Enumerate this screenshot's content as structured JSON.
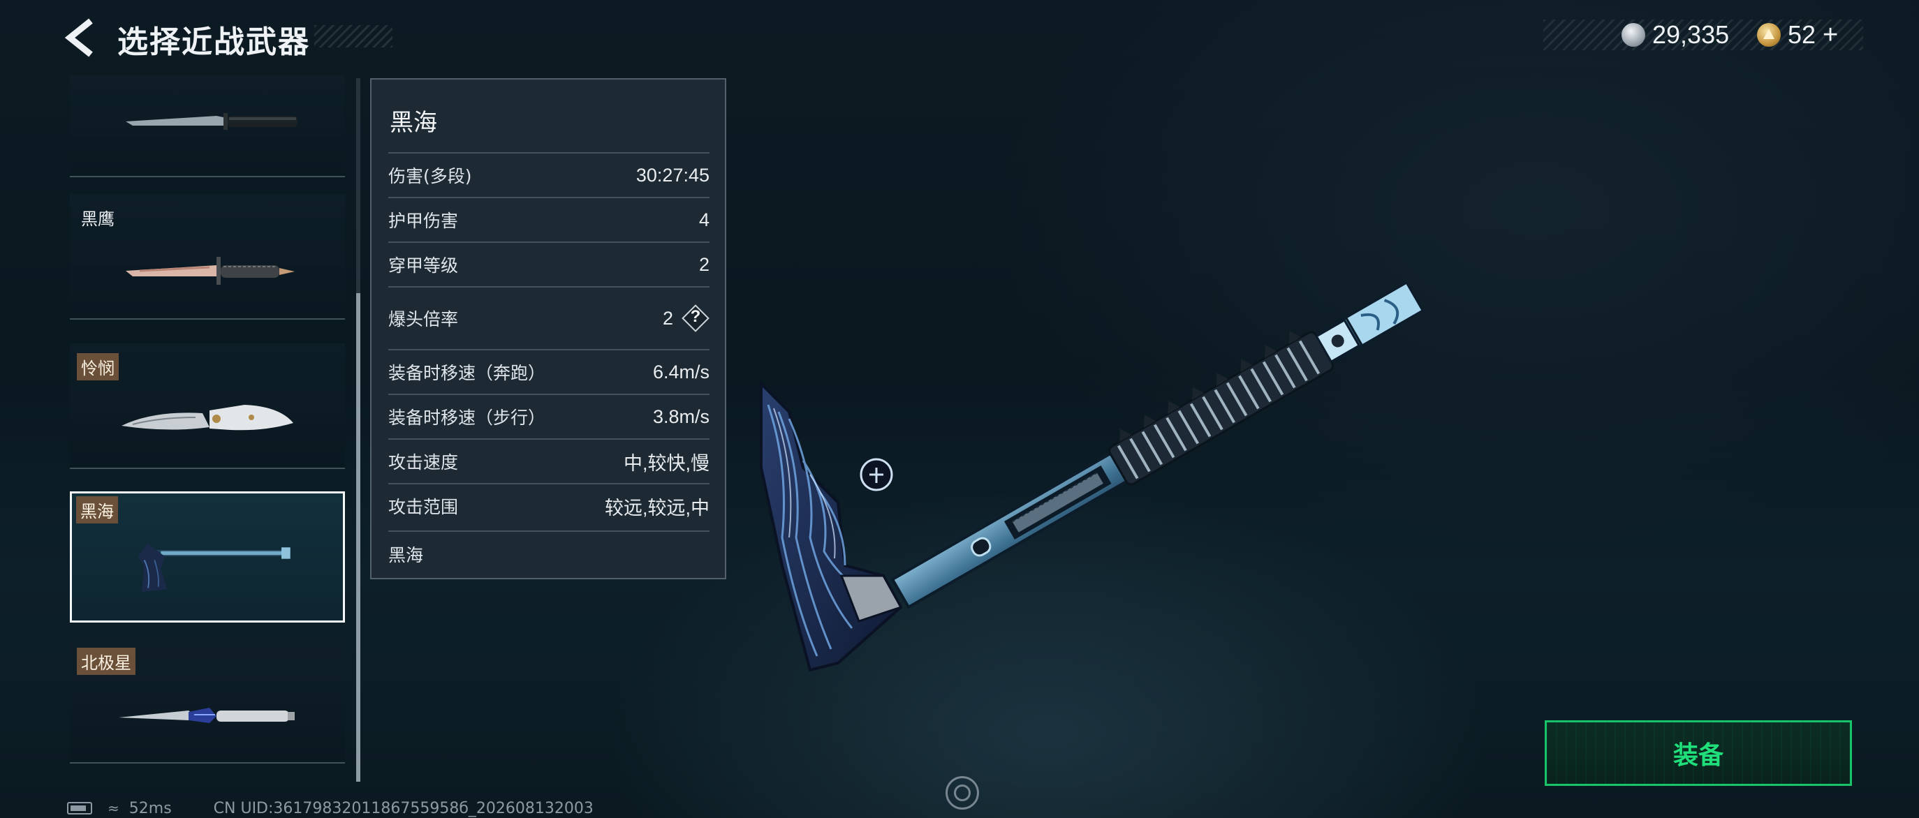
{
  "header": {
    "title": "选择近战武器"
  },
  "currency": {
    "silver_amount": "29,335",
    "gold_amount": "52",
    "gold_add_symbol": "+"
  },
  "weapon_list": [
    {
      "name": "",
      "tag_style": false,
      "selected": false
    },
    {
      "name": "黑鹰",
      "tag_style": false,
      "selected": false
    },
    {
      "name": "怜悯",
      "tag_style": true,
      "selected": false
    },
    {
      "name": "黑海",
      "tag_style": true,
      "selected": true
    },
    {
      "name": "北极星",
      "tag_style": true,
      "selected": false
    }
  ],
  "stats": {
    "title": "黑海",
    "rows": [
      {
        "label": "伤害(多段)",
        "value": "30:27:45"
      },
      {
        "label": "护甲伤害",
        "value": "4"
      },
      {
        "label": "穿甲等级",
        "value": "2"
      },
      {
        "label": "爆头倍率",
        "value": "2",
        "help": "?"
      },
      {
        "label": "装备时移速（奔跑）",
        "value": "6.4m/s"
      },
      {
        "label": "装备时移速（步行）",
        "value": "3.8m/s"
      },
      {
        "label": "攻击速度",
        "value": "中,较快,慢"
      },
      {
        "label": "攻击范围",
        "value": "较远,较远,中"
      }
    ],
    "footer_text": "黑海"
  },
  "equip_button": {
    "label": "装备"
  },
  "footer": {
    "ping": "52ms",
    "uid": "CN UID:3617983201186755958б_202608132003"
  },
  "colors": {
    "accent_green": "#1fe07a",
    "tag_bg": "#6a5038",
    "background": "#0b1a21"
  }
}
